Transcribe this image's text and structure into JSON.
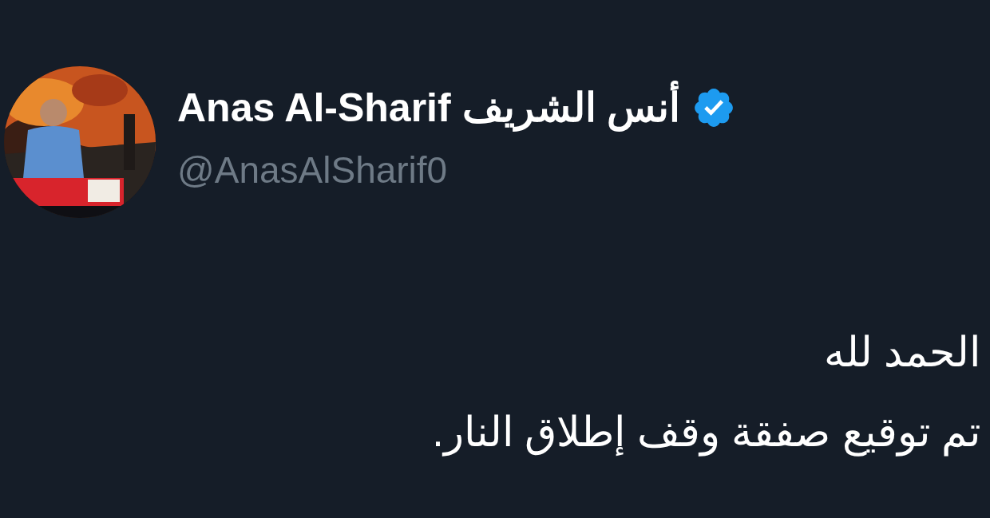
{
  "author": {
    "name": "Anas Al-Sharif أنس الشريف",
    "verified": true,
    "handle": "@AnasAlSharif0"
  },
  "tweet": {
    "lines": [
      "الحمد لله",
      "تم توقيع صفقة وقف إطلاق النار."
    ]
  }
}
